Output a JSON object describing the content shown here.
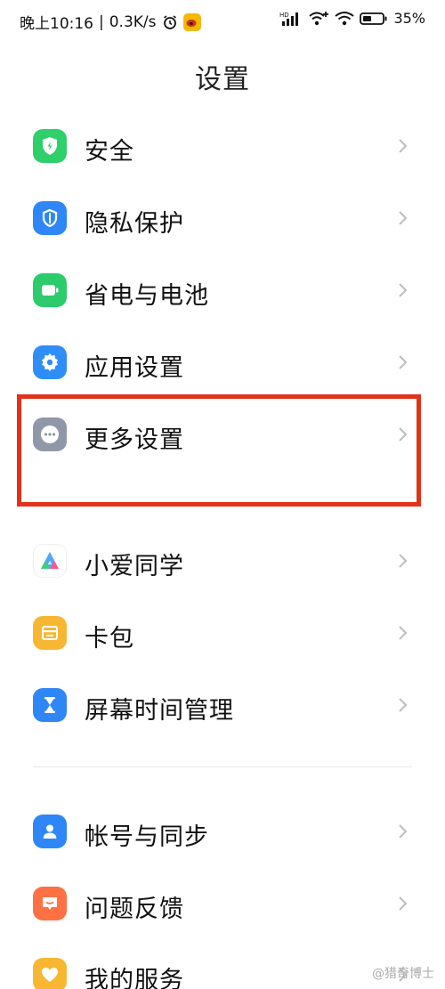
{
  "status_bar": {
    "time": "晚上10:16",
    "speed": "0.3K/s",
    "battery": "35%",
    "net_badge": "HD"
  },
  "title": "设置",
  "items": [
    {
      "label": "安全",
      "icon": "shield-icon",
      "color": "#2fcf6a"
    },
    {
      "label": "隐私保护",
      "icon": "privacy-icon",
      "color": "#2f86f6"
    },
    {
      "label": "省电与电池",
      "icon": "battery-icon",
      "color": "#2ccb6c"
    },
    {
      "label": "应用设置",
      "icon": "gear-icon",
      "color": "#2f8ef6"
    },
    {
      "label": "更多设置",
      "icon": "more-icon",
      "color": "#8e98a8"
    },
    {
      "label": "小爱同学",
      "icon": "xiaoai-icon",
      "color": "#ffffff"
    },
    {
      "label": "卡包",
      "icon": "wallet-icon",
      "color": "#f7b733"
    },
    {
      "label": "屏幕时间管理",
      "icon": "hourglass-icon",
      "color": "#2f86f6"
    },
    {
      "label": "帐号与同步",
      "icon": "account-icon",
      "color": "#2f86f6"
    },
    {
      "label": "问题反馈",
      "icon": "feedback-icon",
      "color": "#ff7043"
    },
    {
      "label": "我的服务",
      "icon": "heart-icon",
      "color": "#f7b733"
    }
  ],
  "highlight_color": "#e2321a",
  "watermark": "@猎奇博士"
}
